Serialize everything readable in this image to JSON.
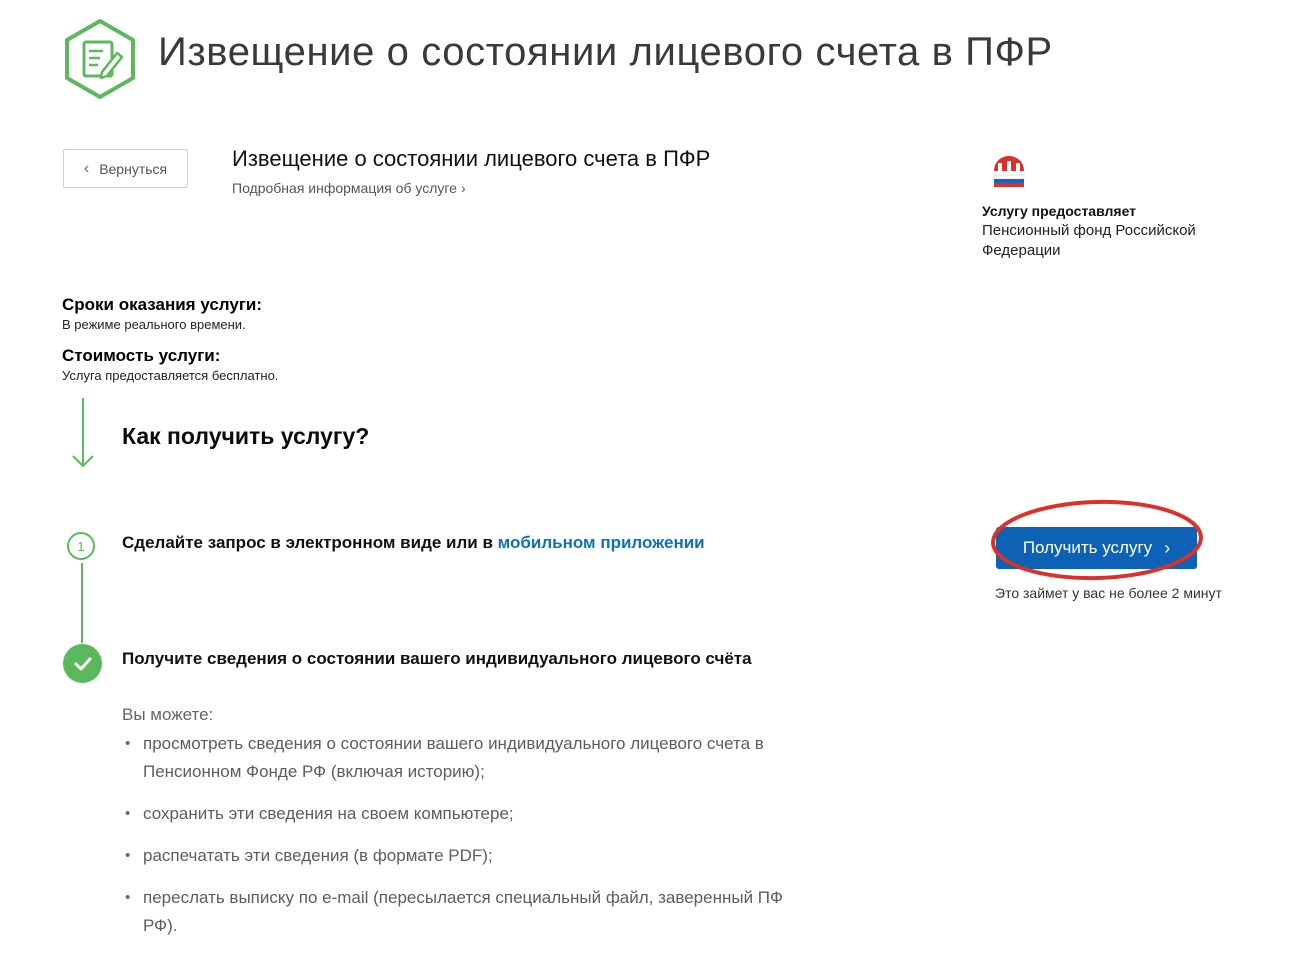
{
  "header": {
    "title": "Извещение о состоянии лицевого счета в ПФР"
  },
  "back": {
    "label": "Вернуться"
  },
  "service": {
    "title": "Извещение о состоянии лицевого счета в ПФР",
    "more_link": "Подробная информация об услуге"
  },
  "provider": {
    "label": "Услугу предоставляет",
    "name": "Пенсионный фонд Российской Федерации"
  },
  "terms": {
    "deadline_label": "Сроки оказания услуги:",
    "deadline_value": "В режиме реального времени.",
    "cost_label": "Стоимость услуги:",
    "cost_value": "Услуга предоставляется бесплатно."
  },
  "how": {
    "title": "Как получить услугу?",
    "step1_number": "1",
    "step1_text": "Сделайте запрос в электронном виде или в",
    "step1_link": "мобильном приложении",
    "step2_text": "Получите сведения о состоянии вашего индивидуального лицевого счёта"
  },
  "cta": {
    "button_label": "Получить услугу",
    "note": "Это займет у вас не более 2 минут"
  },
  "can_do": {
    "intro": "Вы можете:",
    "items": [
      "просмотреть сведения о состоянии вашего индивидуального лицевого счета в Пенсионном Фонде РФ (включая историю);",
      "сохранить эти сведения на своем компьютере;",
      "распечатать эти сведения (в формате PDF);",
      "переслать выписку по e-mail (пересылается специальный файл, заверенный ПФ РФ)."
    ]
  },
  "colors": {
    "green": "#5cb85c",
    "blue_button": "#0d62b5",
    "link": "#0d72b9",
    "highlight_ring": "#d9312b"
  }
}
